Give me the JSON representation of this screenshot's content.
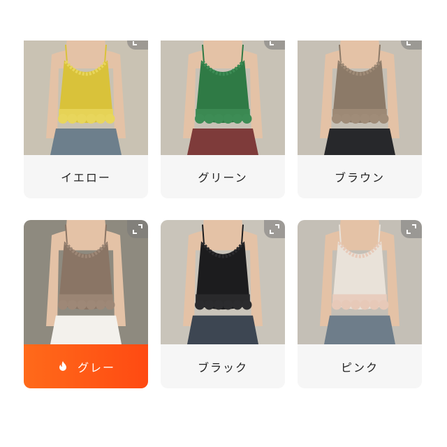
{
  "products": [
    {
      "label": "イエロー",
      "top_color": "#d9c23a",
      "lace_color": "#e8d65c",
      "bottom_color": "#6d7f8c",
      "bg_color": "#c9c2b3",
      "selected": false
    },
    {
      "label": "グリーン",
      "top_color": "#2f7a45",
      "lace_color": "#3d8c55",
      "bottom_color": "#7e3b3a",
      "bg_color": "#c8c2b6",
      "selected": false
    },
    {
      "label": "ブラウン",
      "top_color": "#8c7a68",
      "lace_color": "#a08c78",
      "bottom_color": "#27282b",
      "bg_color": "#c6c0b5",
      "selected": false
    },
    {
      "label": "グレー",
      "top_color": "#8a7565",
      "lace_color": "#9e8877",
      "bottom_color": "#f3f1ec",
      "bg_color": "#8e8a7f",
      "selected": true
    },
    {
      "label": "ブラック",
      "top_color": "#1c1c1e",
      "lace_color": "#2b2b2e",
      "bottom_color": "#3d4652",
      "bg_color": "#c9c4ba",
      "selected": false
    },
    {
      "label": "ピンク",
      "top_color": "#e9e2d9",
      "lace_color": "#e7c9b8",
      "bottom_color": "#6e7d8a",
      "bg_color": "#c4bfb6",
      "selected": false
    }
  ],
  "icons": {
    "expand": "expand-icon",
    "flame": "flame-icon"
  },
  "colors": {
    "accent": "#ff5a14",
    "card_bg": "#f6f6f6"
  }
}
